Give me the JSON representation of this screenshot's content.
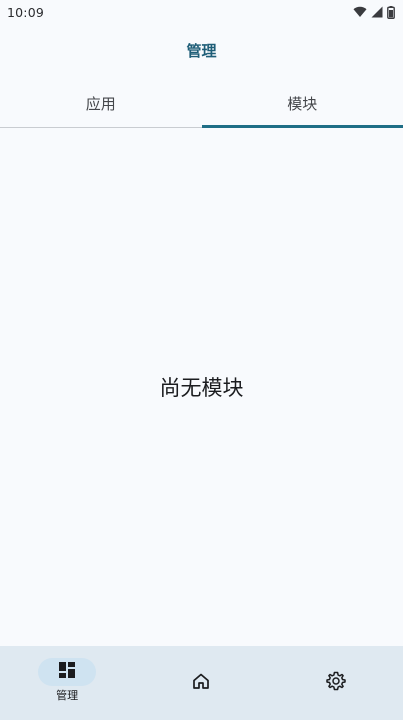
{
  "status_bar": {
    "time": "10:09",
    "icons": [
      "wifi-icon",
      "signal-icon",
      "battery-icon"
    ]
  },
  "app_bar": {
    "title": "管理"
  },
  "tabs": [
    {
      "label": "应用",
      "active": false
    },
    {
      "label": "模块",
      "active": true
    }
  ],
  "empty_state": {
    "text": "尚无模块"
  },
  "bottom_nav": {
    "items": [
      {
        "label": "管理",
        "icon": "dashboard-icon",
        "active": true
      },
      {
        "label": "",
        "icon": "home-icon",
        "active": false
      },
      {
        "label": "",
        "icon": "gear-icon",
        "active": false
      }
    ]
  },
  "colors": {
    "accent": "#1f6e86",
    "title": "#1f5e78",
    "background": "#f8fafd",
    "nav_background": "#dfe9f1",
    "nav_pill": "#cfe3f1"
  }
}
